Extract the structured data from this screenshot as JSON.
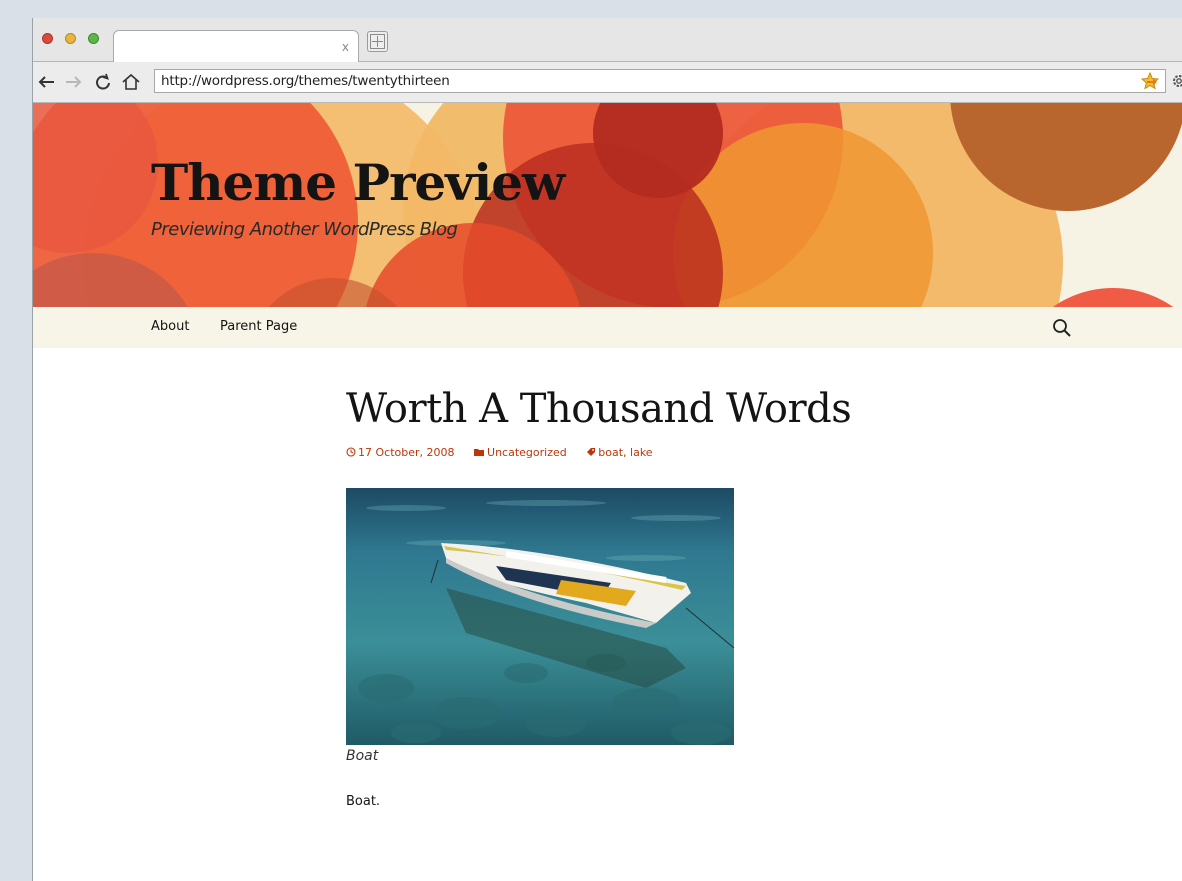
{
  "browser": {
    "tab_close": "x",
    "url": "http://wordpress.org/themes/twentythirteen"
  },
  "site": {
    "title": "Theme Preview",
    "description": "Previewing Another WordPress Blog"
  },
  "nav": {
    "items": [
      {
        "label": "About"
      },
      {
        "label": "Parent Page"
      }
    ]
  },
  "post": {
    "title": "Worth A Thousand Words",
    "date": "17 October, 2008",
    "category": "Uncategorized",
    "tags": [
      "boat",
      "lake"
    ],
    "tag_separator": ", ",
    "caption": "Boat",
    "body": "Boat."
  },
  "colors": {
    "link": "#bc360a",
    "nav_bg": "#f7f5e7",
    "header_bg": "#f6f2e4"
  }
}
